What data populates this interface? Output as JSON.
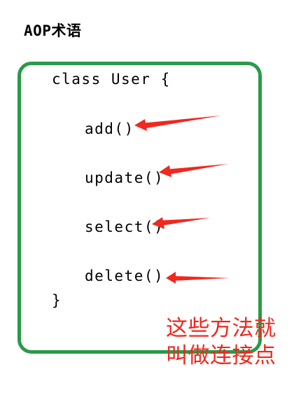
{
  "title": "AOP术语",
  "code": {
    "class_line": "class User {",
    "methods": [
      "add()",
      "update()",
      "select()",
      "delete()"
    ],
    "closing": "}"
  },
  "note": {
    "line1": "这些方法就",
    "line2": "叫做连接点"
  },
  "colors": {
    "frame": "#2a9a48",
    "arrow": "#f0281e",
    "note": "#f0281e"
  },
  "icons": [
    "arrow-icon"
  ]
}
